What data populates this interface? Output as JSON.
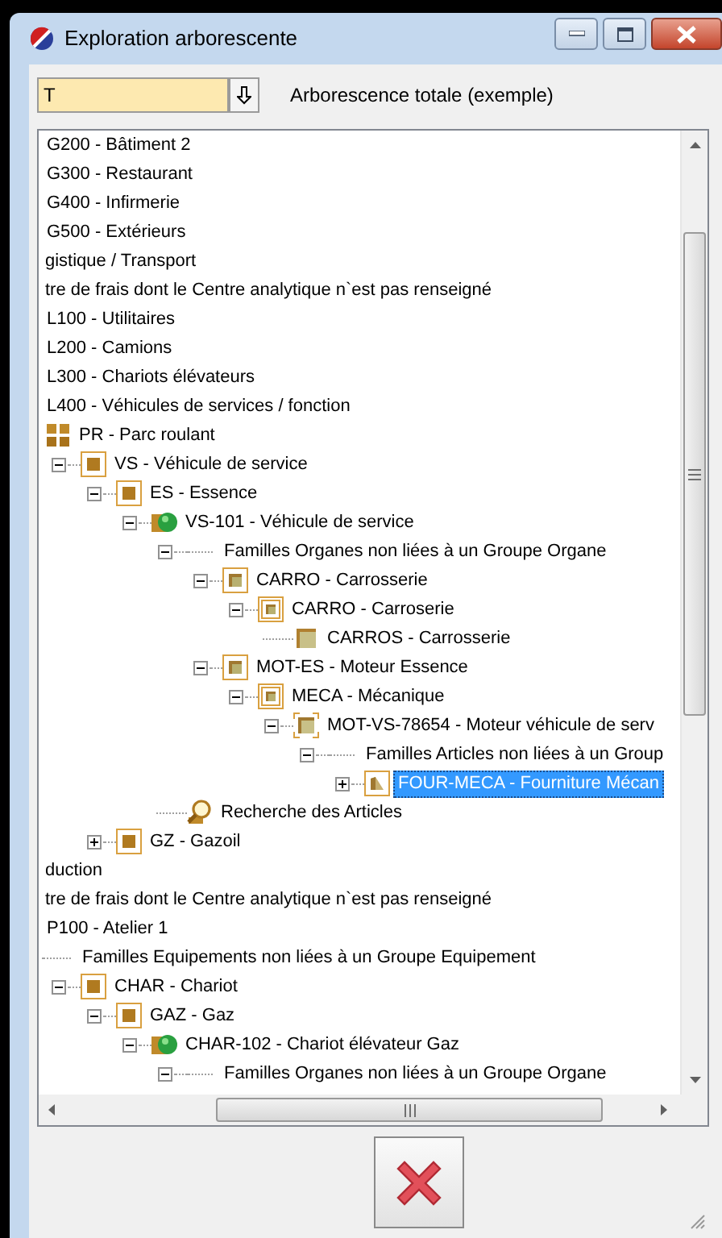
{
  "window": {
    "title": "Exploration arborescente"
  },
  "search": {
    "value": "T"
  },
  "tree_label": "Arborescence totale (exemple)",
  "tree": {
    "items": [
      {
        "children": [
          {
            "children": [
              {
                "label": "G200 - Bâtiment 2",
                "selected": false
              },
              {
                "label": "G300 - Restaurant",
                "selected": false
              },
              {
                "label": "G400 - Infirmerie",
                "selected": false
              },
              {
                "label": "G500 - Extérieurs",
                "selected": false
              }
            ]
          }
        ]
      },
      {
        "label": "gistique / Transport",
        "selected": false,
        "children": [
          {
            "label": "tre de frais dont le Centre analytique n`est pas renseigné",
            "selected": false,
            "children": [
              {
                "label": "L100 - Utilitaires",
                "selected": false
              },
              {
                "label": "L200 - Camions",
                "selected": false
              },
              {
                "label": "L300 - Chariots élévateurs",
                "selected": false
              },
              {
                "label": "L400 - Véhicules de services / fonction",
                "selected": false,
                "children": [
                  {
                    "label": "PR - Parc roulant",
                    "kind": "category",
                    "selected": false,
                    "children": [
                      {
                        "label": "VS - Véhicule de service",
                        "kind": "group",
                        "expanded": true,
                        "selected": false,
                        "children": [
                          {
                            "label": "ES - Essence",
                            "kind": "group",
                            "expanded": true,
                            "selected": false,
                            "children": [
                              {
                                "label": "VS-101 - Véhicule de service",
                                "kind": "equipment",
                                "expanded": true,
                                "selected": false,
                                "children": [
                                  {
                                    "label": "Familles Organes non liées à un Groupe Organe",
                                    "kind": "folder",
                                    "expanded": true,
                                    "selected": false,
                                    "children": [
                                      {
                                        "label": "CARRO - Carrosserie",
                                        "kind": "family",
                                        "expanded": true,
                                        "selected": false,
                                        "children": [
                                          {
                                            "label": "CARRO - Carroserie",
                                            "kind": "subfamily",
                                            "expanded": true,
                                            "selected": false,
                                            "children": [
                                              {
                                                "label": "CARROS - Carrosserie",
                                                "kind": "item",
                                                "selected": false
                                              }
                                            ]
                                          }
                                        ]
                                      },
                                      {
                                        "label": "MOT-ES - Moteur Essence",
                                        "kind": "family",
                                        "expanded": true,
                                        "selected": false,
                                        "children": [
                                          {
                                            "label": "MECA - Mécanique",
                                            "kind": "subfamily",
                                            "expanded": true,
                                            "selected": false,
                                            "children": [
                                              {
                                                "label": "MOT-VS-78654 - Moteur véhicule de serv",
                                                "kind": "part",
                                                "expanded": true,
                                                "selected": false,
                                                "children": [
                                                  {
                                                    "label": "Familles Articles non liées à un Group",
                                                    "kind": "folder",
                                                    "expanded": true,
                                                    "selected": false,
                                                    "children": [
                                                      {
                                                        "label": "FOUR-MECA - Fourniture Mécan",
                                                        "kind": "article",
                                                        "expanded": false,
                                                        "selected": true
                                                      }
                                                    ]
                                                  }
                                                ]
                                              }
                                            ]
                                          }
                                        ]
                                      }
                                    ]
                                  },
                                  {
                                    "label": "Recherche des Articles",
                                    "kind": "search",
                                    "selected": false
                                  }
                                ]
                              }
                            ]
                          },
                          {
                            "label": "GZ - Gazoil",
                            "kind": "group",
                            "expanded": false,
                            "selected": false
                          }
                        ]
                      }
                    ]
                  }
                ]
              }
            ]
          }
        ]
      },
      {
        "label": "duction",
        "selected": false,
        "children": [
          {
            "label": "tre de frais dont le Centre analytique n`est pas renseigné",
            "selected": false,
            "children": [
              {
                "label": "P100 - Atelier 1",
                "selected": false,
                "children": [
                  {
                    "label": "Familles Equipements non liées à un Groupe Equipement",
                    "kind": "folder",
                    "selected": false,
                    "children": [
                      {
                        "label": "CHAR - Chariot",
                        "kind": "group",
                        "expanded": true,
                        "selected": false,
                        "children": [
                          {
                            "label": "GAZ - Gaz",
                            "kind": "group",
                            "expanded": true,
                            "selected": false,
                            "children": [
                              {
                                "label": "CHAR-102 - Chariot élévateur Gaz",
                                "kind": "equipment",
                                "expanded": true,
                                "selected": false,
                                "children": [
                                  {
                                    "label": "Familles Organes non liées à un Groupe Organe",
                                    "kind": "folder",
                                    "expanded": true,
                                    "selected": false
                                  }
                                ]
                              }
                            ]
                          }
                        ]
                      }
                    ]
                  }
                ]
              }
            ]
          }
        ]
      }
    ]
  }
}
